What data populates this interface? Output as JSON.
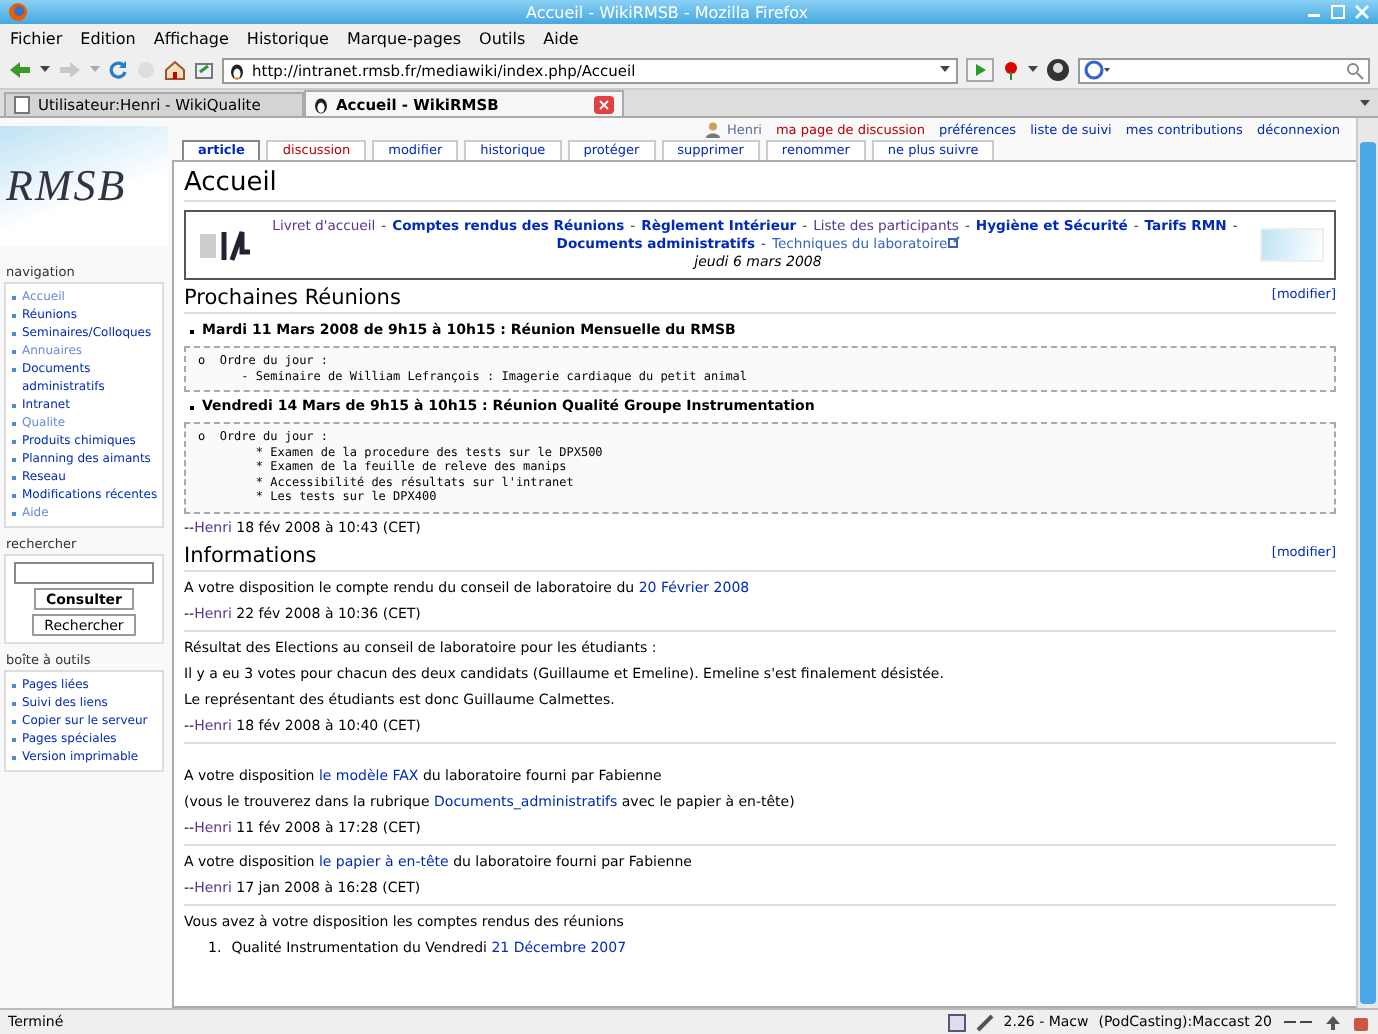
{
  "window": {
    "title": "Accueil - WikiRMSB - Mozilla Firefox"
  },
  "menu": [
    "Fichier",
    "Edition",
    "Affichage",
    "Historique",
    "Marque-pages",
    "Outils",
    "Aide"
  ],
  "toolbar": {
    "url": "http://intranet.rmsb.fr/mediawiki/index.php/Accueil"
  },
  "browser_tabs": [
    {
      "label": "Utilisateur:Henri - WikiQualite",
      "selected": false
    },
    {
      "label": "Accueil - WikiRMSB",
      "selected": true
    }
  ],
  "personal": [
    {
      "label": "Henri",
      "kind": "user"
    },
    {
      "label": "ma page de discussion",
      "kind": "new"
    },
    {
      "label": "préférences",
      "kind": "link"
    },
    {
      "label": "liste de suivi",
      "kind": "link"
    },
    {
      "label": "mes contributions",
      "kind": "link"
    },
    {
      "label": "déconnexion",
      "kind": "link"
    }
  ],
  "page_tabs": [
    {
      "label": "article",
      "selected": true,
      "new": false
    },
    {
      "label": "discussion",
      "selected": false,
      "new": true
    },
    {
      "label": "modifier",
      "selected": false,
      "new": false
    },
    {
      "label": "historique",
      "selected": false,
      "new": false
    },
    {
      "label": "protéger",
      "selected": false,
      "new": false
    },
    {
      "label": "supprimer",
      "selected": false,
      "new": false
    },
    {
      "label": "renommer",
      "selected": false,
      "new": false
    },
    {
      "label": "ne plus suivre",
      "selected": false,
      "new": false
    }
  ],
  "sidebar": {
    "logo": "RMSB",
    "navigation": {
      "title": "navigation",
      "items": [
        {
          "label": "Accueil",
          "visited": true
        },
        {
          "label": "Réunions",
          "visited": false
        },
        {
          "label": "Seminaires/Colloques",
          "visited": false
        },
        {
          "label": "Annuaires",
          "visited": true
        },
        {
          "label": "Documents administratifs",
          "visited": false
        },
        {
          "label": "Intranet",
          "visited": false
        },
        {
          "label": "Qualite",
          "visited": true
        },
        {
          "label": "Produits chimiques",
          "visited": false
        },
        {
          "label": "Planning des aimants",
          "visited": false
        },
        {
          "label": "Reseau",
          "visited": false
        },
        {
          "label": "Modifications récentes",
          "visited": false
        },
        {
          "label": "Aide",
          "visited": true
        }
      ]
    },
    "search": {
      "title": "rechercher",
      "buttons": [
        {
          "label": "Consulter",
          "primary": true
        },
        {
          "label": "Rechercher",
          "primary": false
        }
      ]
    },
    "toolbox": {
      "title": "boîte à outils",
      "items": [
        {
          "label": "Pages liées",
          "visited": false
        },
        {
          "label": "Suivi des liens",
          "visited": false
        },
        {
          "label": "Copier sur le serveur",
          "visited": false
        },
        {
          "label": "Pages spéciales",
          "visited": false
        },
        {
          "label": "Version imprimable",
          "visited": false
        }
      ]
    }
  },
  "page": {
    "title": "Accueil",
    "banner": {
      "separator": "-",
      "date": "jeudi 6 mars 2008",
      "links": [
        {
          "text": "Livret d'accueil",
          "kind": "visited",
          "bold": false
        },
        {
          "text": "Comptes rendus des Réunions",
          "kind": "link",
          "bold": true
        },
        {
          "text": "Règlement Intérieur",
          "kind": "link",
          "bold": true
        },
        {
          "text": "Liste des participants",
          "kind": "visited",
          "bold": false
        },
        {
          "text": "Hygiène et Sécurité",
          "kind": "link",
          "bold": true
        },
        {
          "text": "Tarifs RMN",
          "kind": "link",
          "bold": true
        },
        {
          "text": "Documents administratifs",
          "kind": "link",
          "bold": true
        },
        {
          "text": "Techniques du laboratoire",
          "kind": "external",
          "bold": false
        }
      ]
    },
    "blocks": [
      {
        "kind": "heading",
        "text": "Prochaines Réunions",
        "edit": "[modifier]"
      },
      {
        "kind": "event",
        "text": "Mardi 11 Mars 2008 de 9h15 à 10h15 : Réunion Mensuelle du RMSB"
      },
      {
        "kind": "pre",
        "lines": [
          "o  Ordre du jour :",
          "      - Seminaire de William Lefrançois : Imagerie cardiaque du petit animal"
        ]
      },
      {
        "kind": "event",
        "text": "Vendredi 14 Mars de 9h15 à 10h15 : Réunion Qualité Groupe Instrumentation"
      },
      {
        "kind": "pre",
        "lines": [
          "o  Ordre du jour :",
          "        * Examen de la procedure des tests sur le DPX500",
          "        * Examen de la feuille de releve des manips",
          "        * Accessibilité des résultats sur l'intranet",
          "        * Les tests sur le DPX400"
        ]
      },
      {
        "kind": "signature",
        "parts": [
          {
            "text": "--",
            "kind": "text"
          },
          {
            "text": "Henri",
            "kind": "visited"
          },
          {
            "text": " 18 fév 2008 à 10:43 (CET)",
            "kind": "text"
          }
        ]
      },
      {
        "kind": "heading",
        "text": "Informations",
        "edit": "[modifier]"
      },
      {
        "kind": "para",
        "parts": [
          {
            "text": "A votre disposition le compte rendu du conseil de laboratoire du ",
            "kind": "text"
          },
          {
            "text": "20 Février 2008",
            "kind": "link"
          }
        ]
      },
      {
        "kind": "signature",
        "parts": [
          {
            "text": "--",
            "kind": "text"
          },
          {
            "text": "Henri",
            "kind": "visited"
          },
          {
            "text": " 22 fév 2008 à 10:36 (CET)",
            "kind": "text"
          }
        ]
      },
      {
        "kind": "rule"
      },
      {
        "kind": "para",
        "parts": [
          {
            "text": "Résultat des Elections au conseil de laboratoire pour les étudiants :",
            "kind": "text"
          }
        ]
      },
      {
        "kind": "para",
        "parts": [
          {
            "text": "Il y a eu 3 votes pour chacun des deux candidats (Guillaume et Emeline). Emeline s'est finalement désistée.",
            "kind": "text"
          }
        ]
      },
      {
        "kind": "para",
        "parts": [
          {
            "text": "Le représentant des étudiants est donc Guillaume Calmettes.",
            "kind": "text"
          }
        ]
      },
      {
        "kind": "signature",
        "parts": [
          {
            "text": "--",
            "kind": "text"
          },
          {
            "text": "Henri",
            "kind": "visited"
          },
          {
            "text": " 18 fév 2008 à 10:40 (CET)",
            "kind": "text"
          }
        ]
      },
      {
        "kind": "rule"
      },
      {
        "kind": "spacer"
      },
      {
        "kind": "para",
        "parts": [
          {
            "text": "A votre disposition ",
            "kind": "text"
          },
          {
            "text": "le modèle FAX",
            "kind": "link"
          },
          {
            "text": " du laboratoire fourni par Fabienne",
            "kind": "text"
          }
        ]
      },
      {
        "kind": "para",
        "parts": [
          {
            "text": "(vous le trouverez dans la rubrique ",
            "kind": "text"
          },
          {
            "text": "Documents_administratifs",
            "kind": "link"
          },
          {
            "text": " avec le papier à en-tête)",
            "kind": "text"
          }
        ]
      },
      {
        "kind": "signature",
        "parts": [
          {
            "text": "--",
            "kind": "text"
          },
          {
            "text": "Henri",
            "kind": "visited"
          },
          {
            "text": " 11 fév 2008 à 17:28 (CET)",
            "kind": "text"
          }
        ]
      },
      {
        "kind": "rule"
      },
      {
        "kind": "para",
        "parts": [
          {
            "text": "A votre disposition ",
            "kind": "text"
          },
          {
            "text": "le papier à en-tête",
            "kind": "link"
          },
          {
            "text": " du laboratoire fourni par Fabienne",
            "kind": "text"
          }
        ]
      },
      {
        "kind": "signature",
        "parts": [
          {
            "text": "--",
            "kind": "text"
          },
          {
            "text": "Henri",
            "kind": "visited"
          },
          {
            "text": " 17 jan 2008 à 16:28 (CET)",
            "kind": "text"
          }
        ]
      },
      {
        "kind": "rule"
      },
      {
        "kind": "para",
        "parts": [
          {
            "text": "Vous avez à votre disposition les comptes rendus des réunions",
            "kind": "text"
          }
        ]
      },
      {
        "kind": "numbered",
        "number": "1.",
        "parts": [
          {
            "text": "Qualité Instrumentation du Vendredi ",
            "kind": "text"
          },
          {
            "text": "21 Décembre 2007",
            "kind": "link"
          }
        ]
      }
    ]
  },
  "status_bar": {
    "text": "Terminé",
    "items": [
      "2.26 - Macw",
      "(PodCasting):Maccast 20"
    ]
  }
}
